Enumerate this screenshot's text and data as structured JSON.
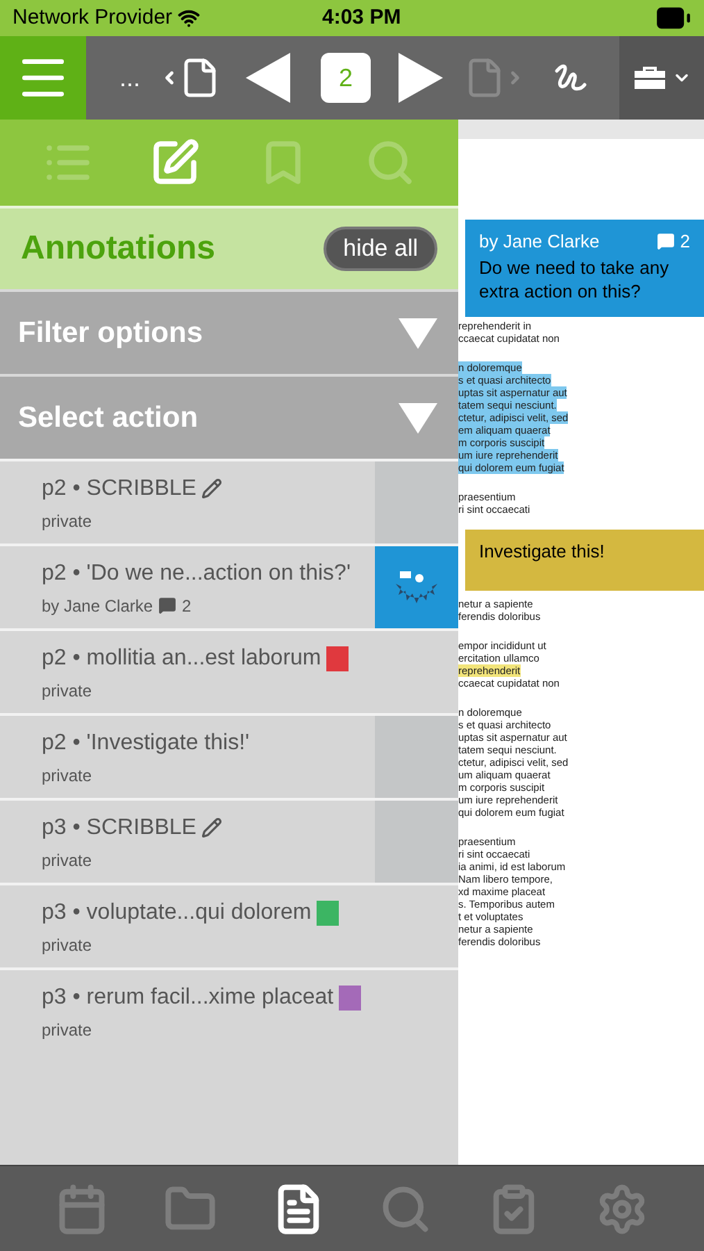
{
  "status_bar": {
    "carrier": "Network Provider",
    "time": "4:03 PM"
  },
  "toolbar": {
    "more": "...",
    "page": "2"
  },
  "panel_tabs": [
    {
      "selected": false
    },
    {
      "selected": true
    },
    {
      "selected": false
    },
    {
      "selected": false
    }
  ],
  "header": {
    "title": "Annotations",
    "button": "hide all"
  },
  "dropdowns": [
    {
      "label": "Filter options",
      "expanded": false
    },
    {
      "label": "Select action",
      "expanded": false
    }
  ],
  "annotations": [
    {
      "kind": "scribble",
      "title": "p2 • SCRIBBLE",
      "subtitle": "private",
      "shaded": true,
      "action_revealed": false
    },
    {
      "kind": "comment",
      "title": "p2 • 'Do we ne...action on this?'",
      "subtitle": "by Jane Clarke",
      "comments": "2",
      "shaded": false,
      "action_revealed": true
    },
    {
      "kind": "color",
      "title": "p2 • mollitia an...est laborum",
      "subtitle": "private",
      "color": "#e0393e",
      "shaded": false,
      "action_revealed": false
    },
    {
      "kind": "note",
      "title": "p2 • 'Investigate this!'",
      "subtitle": "private",
      "shaded": true,
      "action_revealed": false
    },
    {
      "kind": "scribble",
      "title": "p3 • SCRIBBLE",
      "subtitle": "private",
      "shaded": true,
      "action_revealed": false
    },
    {
      "kind": "color",
      "title": "p3 • voluptate...qui dolorem",
      "subtitle": "private",
      "color": "#3cb563",
      "shaded": false,
      "action_revealed": false
    },
    {
      "kind": "color",
      "title": "p3 • rerum facil...xime placeat",
      "subtitle": "private",
      "color": "#a46ab8",
      "shaded": false,
      "action_revealed": false
    }
  ],
  "document": [
    {
      "kind": "comment_note",
      "author": "by Jane Clarke",
      "comments": "2",
      "text": "Do we need to take any extra action on this?"
    },
    {
      "kind": "lines",
      "lines": [
        {
          "text": "reprehenderit in"
        },
        {
          "text": "ccaecat cupidatat non"
        }
      ]
    },
    {
      "kind": "lines",
      "lines": [
        {
          "text": "n doloremque",
          "color": "#7ec8ee"
        },
        {
          "text": "s et quasi architecto",
          "color": "#7ec8ee"
        },
        {
          "text": "uptas sit aspernatur aut",
          "color": "#7ec8ee"
        },
        {
          "text": "tatem sequi nesciunt.",
          "color": "#7ec8ee"
        },
        {
          "text": "ctetur, adipisci velit, sed",
          "color": "#7ec8ee"
        },
        {
          "text": "em aliquam quaerat",
          "color": "#7ec8ee"
        },
        {
          "text": "m corporis suscipit",
          "color": "#7ec8ee"
        },
        {
          "text": "um iure reprehenderit",
          "color": "#7ec8ee"
        },
        {
          "text": "qui dolorem eum fugiat",
          "color": "#7ec8ee"
        }
      ]
    },
    {
      "kind": "lines",
      "lines": [
        {
          "text": "praesentium"
        },
        {
          "text": "ri sint occaecati"
        }
      ]
    },
    {
      "kind": "note",
      "text": "Investigate this!"
    },
    {
      "kind": "lines",
      "lines": [
        {
          "text": "netur a sapiente"
        },
        {
          "text": "ferendis doloribus"
        }
      ]
    },
    {
      "kind": "lines",
      "lines": [
        {
          "text": "empor incididunt ut"
        },
        {
          "text": "ercitation ullamco"
        },
        {
          "text": "reprehenderit",
          "color": "#f2e47a"
        },
        {
          "text": "ccaecat cupidatat non"
        }
      ]
    },
    {
      "kind": "lines",
      "lines": [
        {
          "text": "n doloremque"
        },
        {
          "text": "s et quasi architecto"
        },
        {
          "text": "uptas sit aspernatur aut"
        },
        {
          "text": "tatem sequi nesciunt."
        },
        {
          "text": "ctetur, adipisci velit, sed"
        },
        {
          "text": "um aliquam quaerat"
        },
        {
          "text": "m corporis suscipit"
        },
        {
          "text": "um iure reprehenderit"
        },
        {
          "text": "qui dolorem eum fugiat"
        }
      ]
    },
    {
      "kind": "lines",
      "lines": [
        {
          "text": "praesentium"
        },
        {
          "text": "ri sint occaecati"
        },
        {
          "text": "ia animi, id est laborum"
        },
        {
          "text": "Nam libero tempore,"
        },
        {
          "text": "xd maxime placeat"
        },
        {
          "text": "s. Temporibus autem"
        },
        {
          "text": "t et voluptates"
        },
        {
          "text": "netur a sapiente"
        },
        {
          "text": "ferendis doloribus"
        }
      ]
    }
  ],
  "bottom_bar": [
    {
      "selected": false
    },
    {
      "selected": false
    },
    {
      "selected": true
    },
    {
      "selected": false
    },
    {
      "selected": false
    },
    {
      "selected": false
    }
  ]
}
